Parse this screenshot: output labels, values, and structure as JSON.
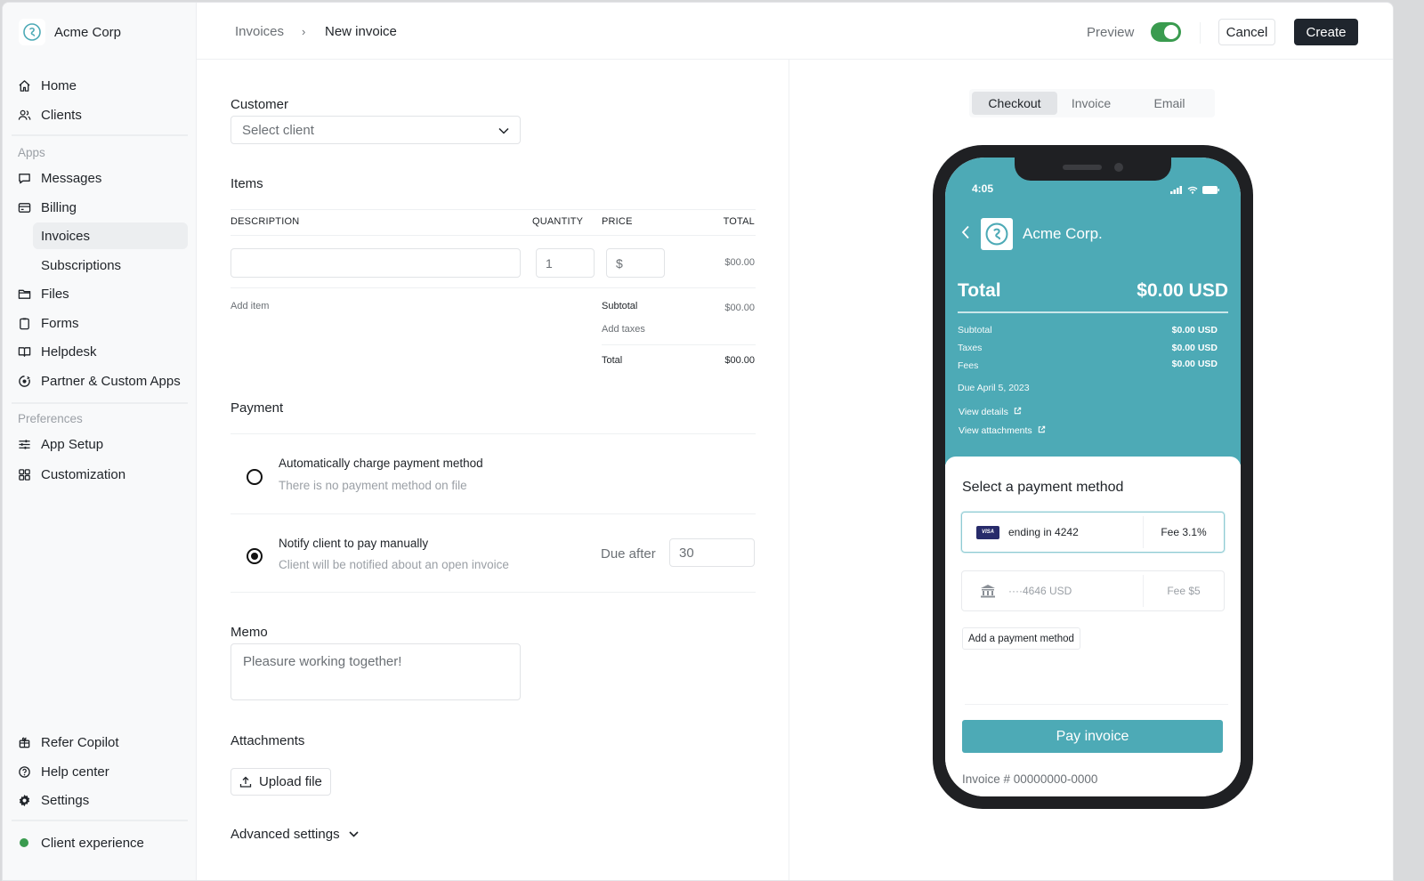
{
  "colors": {
    "accent_teal": "#4daab6",
    "toggle_on": "#3a9b4f",
    "primary_button": "#1f252d",
    "status_dot": "#3a9b4f",
    "visa_blue": "#272b6a"
  },
  "sidebar": {
    "brand": {
      "name": "Acme Corp",
      "icon": "copilot-logo-icon"
    },
    "primary_items": [
      {
        "label": "Home",
        "icon": "home-icon"
      },
      {
        "label": "Clients",
        "icon": "users-icon"
      }
    ],
    "apps_section_label": "Apps",
    "apps_items": [
      {
        "label": "Messages",
        "icon": "message-icon"
      },
      {
        "label": "Billing",
        "icon": "credit-card-icon"
      }
    ],
    "billing_subitems": [
      {
        "label": "Invoices",
        "active": true
      },
      {
        "label": "Subscriptions",
        "active": false
      }
    ],
    "apps_items_2": [
      {
        "label": "Files",
        "icon": "folder-icon"
      },
      {
        "label": "Forms",
        "icon": "clipboard-icon"
      },
      {
        "label": "Helpdesk",
        "icon": "book-icon"
      },
      {
        "label": "Partner & Custom Apps",
        "icon": "apps-icon"
      }
    ],
    "preferences_section_label": "Preferences",
    "preferences_items": [
      {
        "label": "App Setup",
        "icon": "sliders-icon"
      },
      {
        "label": "Customization",
        "icon": "grid-icon"
      }
    ],
    "footer_items": [
      {
        "label": "Refer Copilot",
        "icon": "gift-icon"
      },
      {
        "label": "Help center",
        "icon": "help-circle-icon"
      },
      {
        "label": "Settings",
        "icon": "gear-icon"
      }
    ],
    "client_experience": {
      "label": "Client experience",
      "status": "online"
    }
  },
  "header": {
    "breadcrumb": {
      "parent": "Invoices",
      "separator": "›",
      "current": "New invoice"
    },
    "preview_label": "Preview",
    "preview_enabled": true,
    "cancel_label": "Cancel",
    "create_label": "Create"
  },
  "form": {
    "customer": {
      "label": "Customer",
      "placeholder": "Select client"
    },
    "items": {
      "label": "Items",
      "columns": [
        "DESCRIPTION",
        "QUANTITY",
        "PRICE",
        "TOTAL"
      ],
      "rows": [
        {
          "description": "",
          "quantity": "1",
          "price": "$",
          "total": "$00.00"
        }
      ],
      "add_item_label": "Add item",
      "subtotal_label": "Subtotal",
      "subtotal_value": "$00.00",
      "add_taxes_label": "Add taxes",
      "total_label": "Total",
      "total_value": "$00.00"
    },
    "payment": {
      "label": "Payment",
      "options": [
        {
          "title": "Automatically charge payment method",
          "subtitle": "There is no payment method on file",
          "selected": false
        },
        {
          "title": "Notify client to pay manually",
          "subtitle": "Client will be notified about an open invoice",
          "selected": true
        }
      ],
      "due_after_label": "Due after",
      "due_after_value": "30"
    },
    "memo": {
      "label": "Memo",
      "placeholder": "Pleasure working together!"
    },
    "attachments": {
      "label": "Attachments",
      "upload_label": "Upload file"
    },
    "advanced_label": "Advanced settings"
  },
  "preview": {
    "tabs": [
      {
        "label": "Checkout",
        "active": true
      },
      {
        "label": "Invoice",
        "active": false
      },
      {
        "label": "Email",
        "active": false
      }
    ],
    "phone": {
      "time": "4:05",
      "company": "Acme Corp.",
      "total_label": "Total",
      "total_value": "$0.00 USD",
      "breakdown": [
        {
          "label": "Subtotal",
          "value": "$0.00 USD"
        },
        {
          "label": "Taxes",
          "value": "$0.00 USD"
        },
        {
          "label": "Fees",
          "value": "$0.00 USD"
        }
      ],
      "due_date": "Due April 5, 2023",
      "links": [
        "View details",
        "View attachments"
      ],
      "payment_title": "Select a payment method",
      "payment_methods": [
        {
          "type": "visa",
          "text": "ending in 4242",
          "fee": "Fee 3.1%",
          "selected": true
        },
        {
          "type": "bank",
          "text": "····4646 USD",
          "fee": "Fee $5",
          "selected": false
        }
      ],
      "add_method_label": "Add a payment method",
      "pay_label": "Pay invoice",
      "invoice_number": "Invoice # 00000000-0000"
    }
  }
}
